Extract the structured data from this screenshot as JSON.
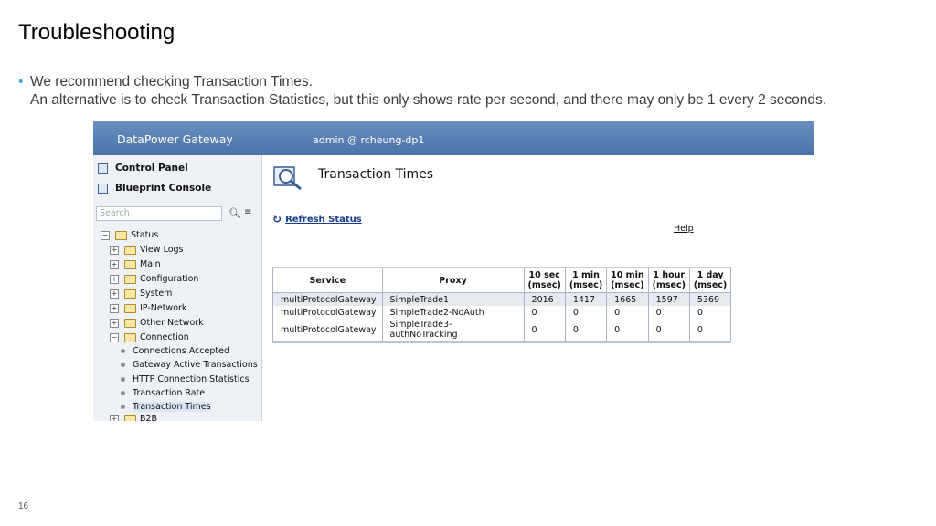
{
  "slide": {
    "title": "Troubleshooting",
    "bullet_line1": "We recommend checking Transaction Times.",
    "bullet_line2": "An alternative is to check Transaction Statistics, but this only shows rate per second, and there may only be 1 every 2 seconds.",
    "page_number": "16",
    "accent_color": "#3fa9d5"
  },
  "app": {
    "brand": "DataPower Gateway",
    "user": "admin @ rcheung-dp1",
    "header_color": "#5a80b4"
  },
  "sidebar": {
    "control_panel": "Control Panel",
    "blueprint_console": "Blueprint Console",
    "search_placeholder": "Search",
    "tree": [
      {
        "label": "Status",
        "expand": "−"
      },
      {
        "label": "View Logs",
        "expand": "+"
      },
      {
        "label": "Main",
        "expand": "+"
      },
      {
        "label": "Configuration",
        "expand": "+"
      },
      {
        "label": "System",
        "expand": "+"
      },
      {
        "label": "IP-Network",
        "expand": "+"
      },
      {
        "label": "Other Network",
        "expand": "+"
      },
      {
        "label": "Connection",
        "expand": "−"
      },
      {
        "label": "Connections Accepted"
      },
      {
        "label": "Gateway Active Transactions"
      },
      {
        "label": "HTTP Connection Statistics"
      },
      {
        "label": "Transaction Rate"
      },
      {
        "label": "Transaction Times",
        "selected": true
      },
      {
        "label": "B2B",
        "expand": "+"
      }
    ]
  },
  "main": {
    "title": "Transaction Times",
    "refresh_label": "Refresh Status",
    "help_label": "Help",
    "table": {
      "headers": [
        "Service",
        "Proxy",
        "10 sec",
        "1 min",
        "10 min",
        "1 hour",
        "1 day"
      ],
      "subheaders": [
        "",
        "",
        "(msec)",
        "(msec)",
        "(msec)",
        "(msec)",
        "(msec)"
      ],
      "rows": [
        [
          "multiProtocolGateway",
          "SimpleTrade1",
          "2016",
          "1417",
          "1665",
          "1597",
          "5369"
        ],
        [
          "multiProtocolGateway",
          "SimpleTrade2-NoAuth",
          "0",
          "0",
          "0",
          "0",
          "0"
        ],
        [
          "multiProtocolGateway",
          "SimpleTrade3-authNoTracking",
          "0",
          "0",
          "0",
          "0",
          "0"
        ]
      ]
    }
  }
}
